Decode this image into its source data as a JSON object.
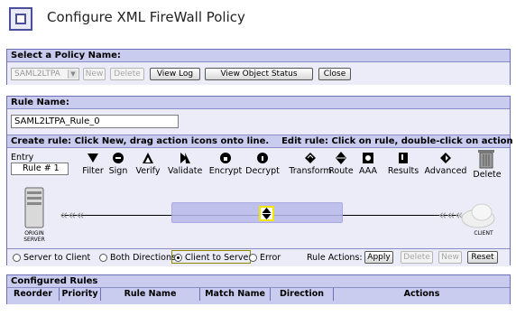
{
  "header": {
    "title": "Configure XML FireWall Policy"
  },
  "policy": {
    "section_label": "Select a Policy Name:",
    "selected": "SAML2LTPA",
    "new_label": "New",
    "delete_label": "Delete",
    "view_log_label": "View Log",
    "view_object_status_label": "View Object Status",
    "close_label": "Close"
  },
  "rule": {
    "section_label": "Rule Name:",
    "name_value": "SAML2LTPA_Rule_0",
    "instructions": "Create rule: Click New, drag action icons onto line.    Edit rule: Click on rule, double-click on action",
    "entry_label": "Entry",
    "rule_number": "Rule # 1",
    "actions": [
      {
        "name": "filter-icon",
        "label": "Filter"
      },
      {
        "name": "sign-icon",
        "label": "Sign"
      },
      {
        "name": "verify-icon",
        "label": "Verify"
      },
      {
        "name": "validate-icon",
        "label": "Validate"
      },
      {
        "name": "encrypt-icon",
        "label": "Encrypt"
      },
      {
        "name": "decrypt-icon",
        "label": "Decrypt"
      },
      {
        "name": "transform-icon",
        "label": "Transform"
      },
      {
        "name": "route-icon",
        "label": "Route"
      },
      {
        "name": "aaa-icon",
        "label": "AAA"
      },
      {
        "name": "results-icon",
        "label": "Results"
      },
      {
        "name": "advanced-icon",
        "label": "Advanced"
      }
    ],
    "delete_label": "Delete",
    "origin_label": "ORIGIN SERVER",
    "client_label": "CLIENT",
    "directions": [
      {
        "label": "Server to Client",
        "selected": false
      },
      {
        "label": "Both Directions",
        "selected": false
      },
      {
        "label": "Client to Server",
        "selected": true
      },
      {
        "label": "Error",
        "selected": false
      }
    ],
    "rule_actions_label": "Rule Actions:",
    "apply_label": "Apply",
    "delete_btn_label": "Delete",
    "new_btn_label": "New",
    "reset_label": "Reset"
  },
  "configured": {
    "section_label": "Configured Rules",
    "columns": [
      "Reorder",
      "Priority",
      "Rule Name",
      "Match Name",
      "Direction",
      "Actions"
    ]
  },
  "colors": {
    "panel_bar": "#c9cbef",
    "panel_body": "#ececf8",
    "border": "#6b6fb5",
    "highlight": "#f2e600"
  }
}
